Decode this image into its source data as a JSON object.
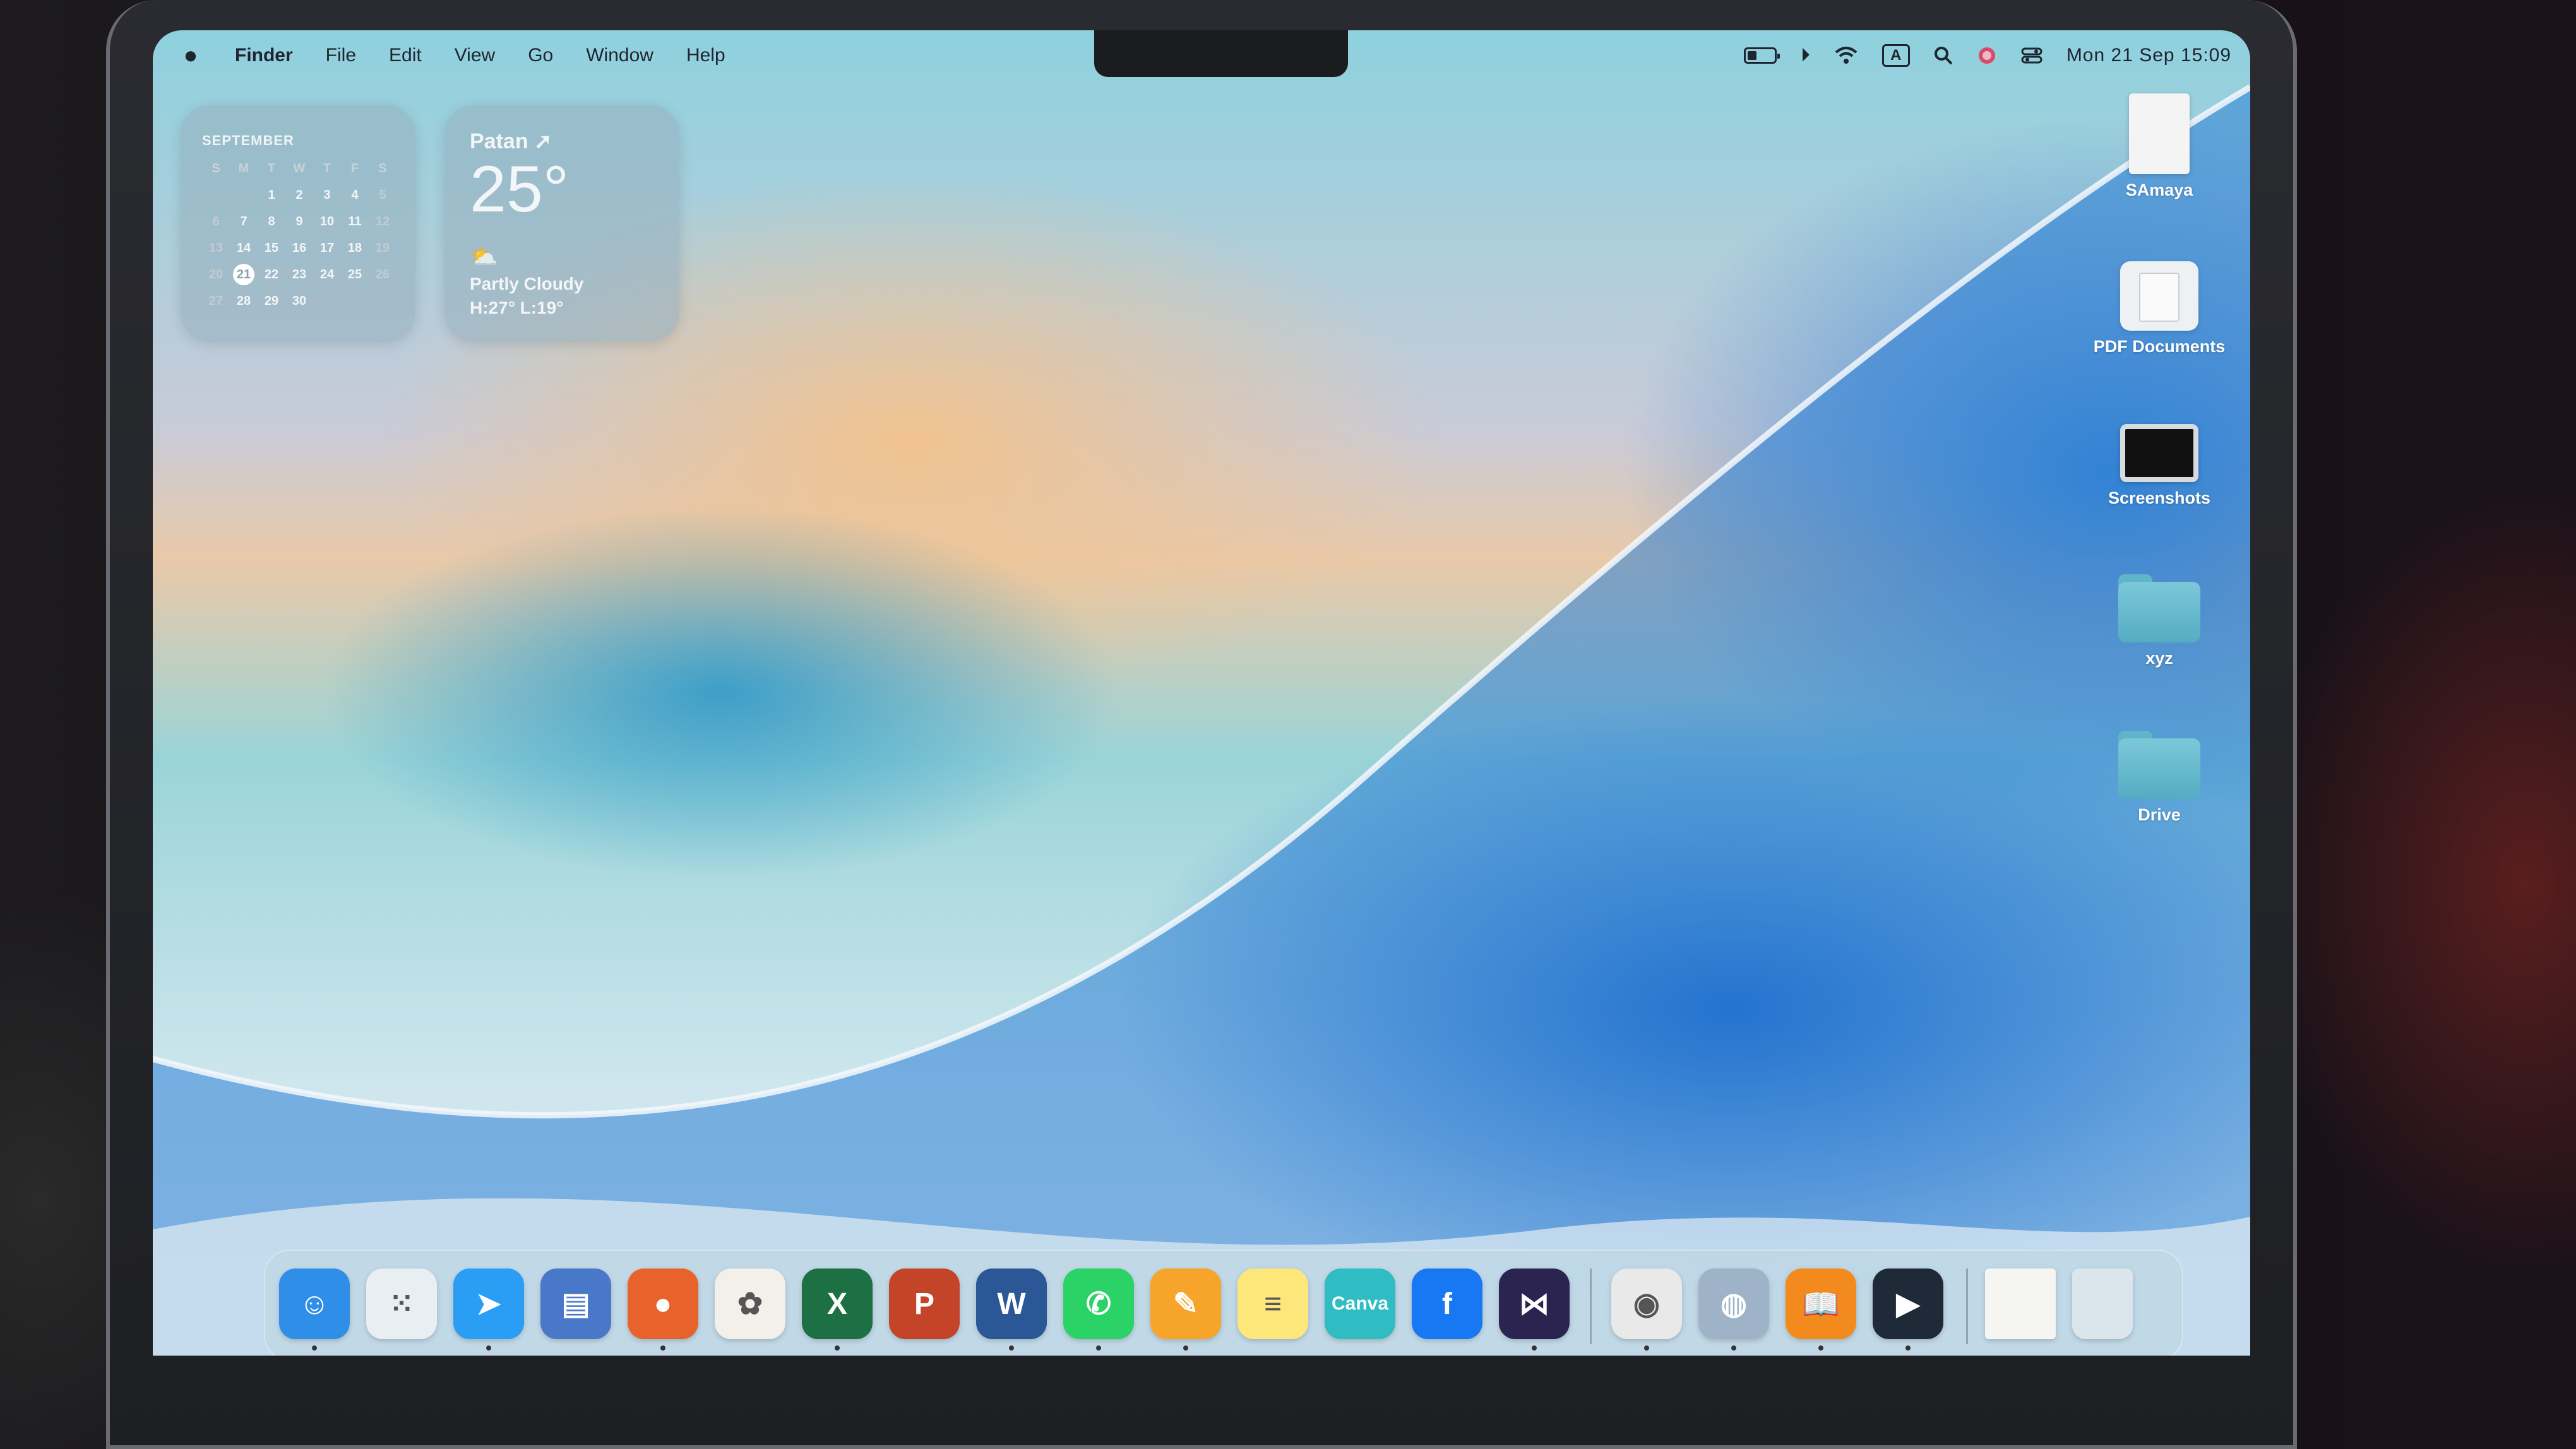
{
  "menubar": {
    "app_name": "Finder",
    "items": [
      "File",
      "Edit",
      "View",
      "Go",
      "Window",
      "Help"
    ],
    "input_source": "A",
    "clock": "Mon 21 Sep  15:09",
    "battery_level": 0.35
  },
  "calendar_widget": {
    "month": "SEPTEMBER",
    "weekdays": [
      "S",
      "M",
      "T",
      "W",
      "T",
      "F",
      "S"
    ],
    "today": "21",
    "days": [
      "",
      "",
      "1",
      "2",
      "3",
      "4",
      "5",
      "6",
      "7",
      "8",
      "9",
      "10",
      "11",
      "12",
      "13",
      "14",
      "15",
      "16",
      "17",
      "18",
      "19",
      "20",
      "21",
      "22",
      "23",
      "24",
      "25",
      "26",
      "27",
      "28",
      "29",
      "30"
    ]
  },
  "weather_widget": {
    "city": "Patan",
    "temperature": "25°",
    "condition": "Partly Cloudy",
    "high_low": "H:27° L:19°",
    "icon": "partly-cloudy-icon"
  },
  "desktop_icons": [
    {
      "label": "SAmaya",
      "icon": "document-icon"
    },
    {
      "label": "PDF Documents",
      "icon": "folder-icon"
    },
    {
      "label": "Screenshots",
      "icon": "screenshot-icon"
    },
    {
      "label": "xyz",
      "icon": "folder-icon"
    },
    {
      "label": "Drive",
      "icon": "folder-icon"
    }
  ],
  "dock": {
    "apps": [
      {
        "name": "Finder",
        "icon": "finder-icon",
        "glyph": "☺",
        "color": "#2f8ee8"
      },
      {
        "name": "Launchpad",
        "icon": "launchpad-icon",
        "glyph": "⁙",
        "color": "#e9eef2"
      },
      {
        "name": "Safari",
        "icon": "safari-icon",
        "glyph": "➤",
        "color": "#2a9df4"
      },
      {
        "name": "Preview",
        "icon": "preview-icon",
        "glyph": "▤",
        "color": "#4a78c8"
      },
      {
        "name": "Firefox",
        "icon": "firefox-icon",
        "glyph": "●",
        "color": "#e8632b"
      },
      {
        "name": "Photos",
        "icon": "photos-icon",
        "glyph": "✿",
        "color": "#f3f0ea"
      },
      {
        "name": "Excel",
        "icon": "excel-icon",
        "glyph": "X",
        "color": "#1d7044"
      },
      {
        "name": "PowerPoint",
        "icon": "powerpoint-icon",
        "glyph": "P",
        "color": "#c4442a"
      },
      {
        "name": "Word",
        "icon": "word-icon",
        "glyph": "W",
        "color": "#2b5797"
      },
      {
        "name": "WhatsApp",
        "icon": "whatsapp-icon",
        "glyph": "✆",
        "color": "#2bd366"
      },
      {
        "name": "Pages",
        "icon": "pages-icon",
        "glyph": "✎",
        "color": "#f7a42b"
      },
      {
        "name": "Notes",
        "icon": "notes-icon",
        "glyph": "≡",
        "color": "#fde77a"
      },
      {
        "name": "Canva",
        "icon": "canva-icon",
        "glyph": "Canva",
        "color": "#2fbcc3"
      },
      {
        "name": "Facebook",
        "icon": "facebook-icon",
        "glyph": "f",
        "color": "#1877f2"
      },
      {
        "name": "Zed",
        "icon": "butterfly-icon",
        "glyph": "⋈",
        "color": "#2b2350"
      },
      {
        "name": "Chrome",
        "icon": "chrome-icon",
        "glyph": "◉",
        "color": "#e9e9e9"
      },
      {
        "name": "Loupe",
        "icon": "loupe-icon",
        "glyph": "◍",
        "color": "#9fb3c8"
      },
      {
        "name": "Books",
        "icon": "books-icon",
        "glyph": "📖",
        "color": "#f28a1e"
      },
      {
        "name": "Infuse",
        "icon": "infuse-icon",
        "glyph": "▶",
        "color": "#1e2a38"
      }
    ],
    "recent": [
      {
        "name": "Document",
        "icon": "recent-document-icon"
      },
      {
        "name": "Trash",
        "icon": "trash-icon"
      }
    ]
  }
}
